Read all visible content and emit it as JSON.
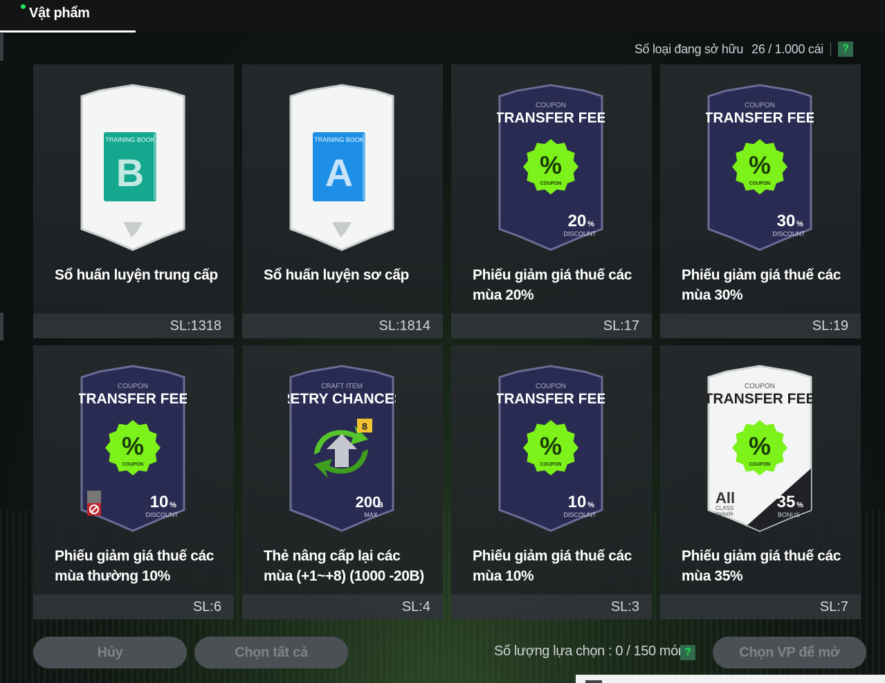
{
  "header": {
    "tab_label": "Vật phẩm"
  },
  "owned": {
    "label": "Số loại đang sở hữu",
    "count": "26 / 1.000 cái",
    "help": "?"
  },
  "items": [
    {
      "name": "Sổ huấn luyện trung cấp",
      "qty": "SL:1318",
      "art": {
        "kind": "book",
        "color": "#14a88e",
        "tag": "TRAINING BOOK",
        "letter": "B"
      }
    },
    {
      "name": "Sổ huấn luyện sơ cấp",
      "qty": "SL:1814",
      "art": {
        "kind": "book",
        "color": "#1e8fe6",
        "tag": "TRAINING BOOK",
        "letter": "A"
      }
    },
    {
      "name": "Phiếu giảm giá thuế các mùa 20%",
      "qty": "SL:17",
      "art": {
        "kind": "coupon",
        "sub": "COUPON",
        "title": "TRANSFER FEE",
        "value": "20",
        "unit": "%",
        "foot": "DISCOUNT",
        "badge": "%",
        "badge_sub": "COUPON"
      }
    },
    {
      "name": "Phiếu giảm giá thuế các mùa 30%",
      "qty": "SL:19",
      "art": {
        "kind": "coupon",
        "sub": "COUPON",
        "title": "TRANSFER FEE",
        "value": "30",
        "unit": "%",
        "foot": "DISCOUNT",
        "badge": "%",
        "badge_sub": "COUPON"
      }
    },
    {
      "name": "Phiếu giảm giá thuế các mùa thường 10%",
      "qty": "SL:6",
      "art": {
        "kind": "coupon",
        "sub": "COUPON",
        "title": "TRANSFER FEE",
        "value": "10",
        "unit": "%",
        "foot": "DISCOUNT",
        "badge": "%",
        "badge_sub": "COUPON",
        "restricted": true
      }
    },
    {
      "name": "Thẻ nâng cấp lại các mùa (+1~+8) (1000 -20B)",
      "qty": "SL:4",
      "art": {
        "kind": "retry",
        "sub": "CRAFT ITEM",
        "title": "RETRY CHANCES",
        "value": "200",
        "unit": "B",
        "foot": "MAX",
        "level": "8"
      }
    },
    {
      "name": "Phiếu giảm giá thuế các mùa 10%",
      "qty": "SL:3",
      "art": {
        "kind": "coupon",
        "sub": "COUPON",
        "title": "TRANSFER FEE",
        "value": "10",
        "unit": "%",
        "foot": "DISCOUNT",
        "badge": "%",
        "badge_sub": "COUPON"
      }
    },
    {
      "name": "Phiếu giảm giá thuế các mùa 35%",
      "qty": "SL:7",
      "art": {
        "kind": "coupon-white",
        "sub": "COUPON",
        "title": "TRANSFER FEE",
        "value": "35",
        "unit": "%",
        "foot": "BONUS",
        "badge": "%",
        "badge_sub": "COUPON",
        "all": "All",
        "class": "CLASS",
        "include": "Include"
      }
    }
  ],
  "footer": {
    "cancel": "Hủy",
    "select_all": "Chọn tất cả",
    "selection": "Số lượng lựa chọn : 0 / 150 món",
    "help": "?",
    "open": "Chọn VP để mở"
  },
  "colors": {
    "accent": "#22e05a",
    "coupon_badge": "#7cf21a",
    "card_bg": "#262a2d"
  }
}
